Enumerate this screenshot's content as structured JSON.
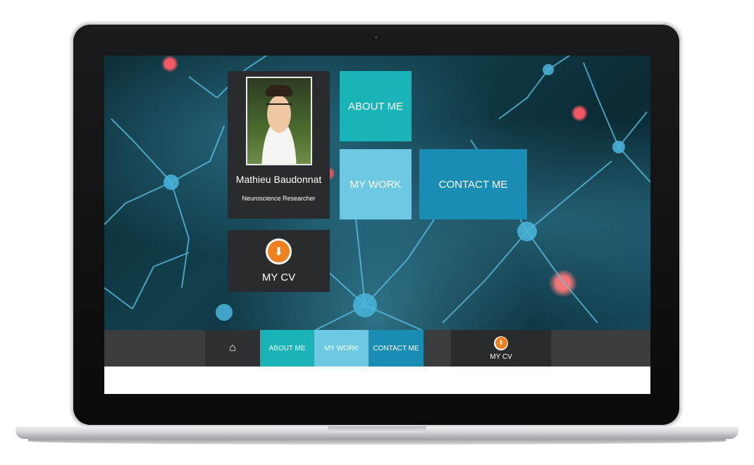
{
  "profile": {
    "name": "Mathieu Baudonnat",
    "role": "Neuroscience Researcher"
  },
  "tiles": {
    "about": "ABOUT ME",
    "work": "MY WORK",
    "contact": "CONTACT ME",
    "cv": "MY CV"
  },
  "nav": {
    "home_icon": "home-icon",
    "about": "ABOUT ME",
    "work": "MY WORK",
    "contact": "CONTACT ME",
    "cv": "MY CV"
  },
  "colors": {
    "about": "#1ab3b8",
    "work": "#6cc8e3",
    "contact": "#1a8db4",
    "dark_tile": "#2a2b2e",
    "cv_icon": "#f07f1e",
    "navbar": "#3b3c3e"
  }
}
